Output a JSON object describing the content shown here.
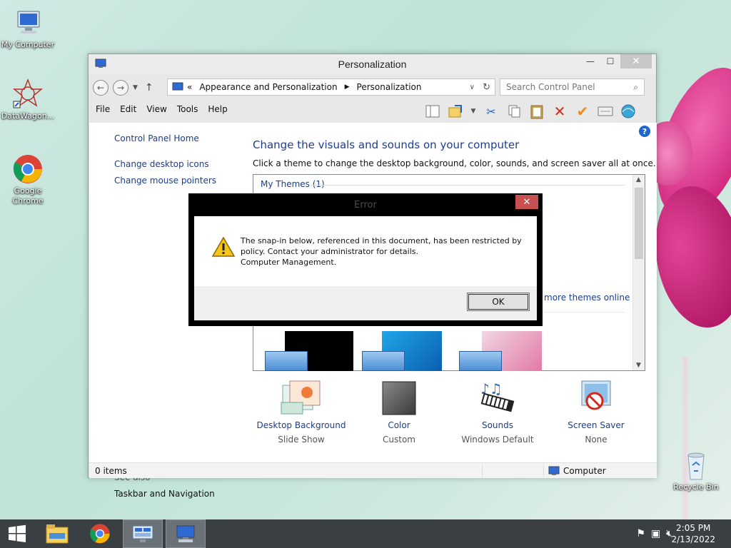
{
  "desktop": {
    "icons": [
      {
        "label": "My Computer"
      },
      {
        "label": "DataWagon..."
      },
      {
        "label": "Google Chrome"
      },
      {
        "label": "Recycle Bin"
      }
    ]
  },
  "window": {
    "title": "Personalization",
    "breadcrumb_prefix": "«",
    "breadcrumbs": [
      "Appearance and Personalization",
      "Personalization"
    ],
    "search_placeholder": "Search Control Panel",
    "menu": [
      "File",
      "Edit",
      "View",
      "Tools",
      "Help"
    ],
    "sidebar": {
      "home": "Control Panel Home",
      "links": [
        "Change desktop icons",
        "Change mouse pointers"
      ],
      "see_also_title": "See also",
      "see_also_links": [
        "Taskbar and Navigation"
      ]
    },
    "heading": "Change the visuals and sounds on your computer",
    "subheading": "Click a theme to change the desktop background, color, sounds, and screen saver all at once.",
    "my_themes": "My Themes (1)",
    "get_more_themes": "more themes online",
    "bottom_items": [
      {
        "label": "Desktop Background",
        "sub": "Slide Show"
      },
      {
        "label": "Color",
        "sub": "Custom"
      },
      {
        "label": "Sounds",
        "sub": "Windows Default"
      },
      {
        "label": "Screen Saver",
        "sub": "None"
      }
    ],
    "status": {
      "items": "0 items",
      "location": "Computer"
    }
  },
  "dialog": {
    "title": "Error",
    "close_glyph": "✕",
    "message_lines": [
      "The snap-in below, referenced in this document, has been restricted by",
      "policy. Contact your administrator for details.",
      "Computer Management."
    ],
    "ok": "OK"
  },
  "taskbar": {
    "time": "2:05 PM",
    "date": "2/13/2022"
  },
  "colors": {
    "link": "#1a3e8c",
    "heading": "#1e3d8f",
    "taskbar": "#3a3f44",
    "close_red": "#c75050"
  }
}
